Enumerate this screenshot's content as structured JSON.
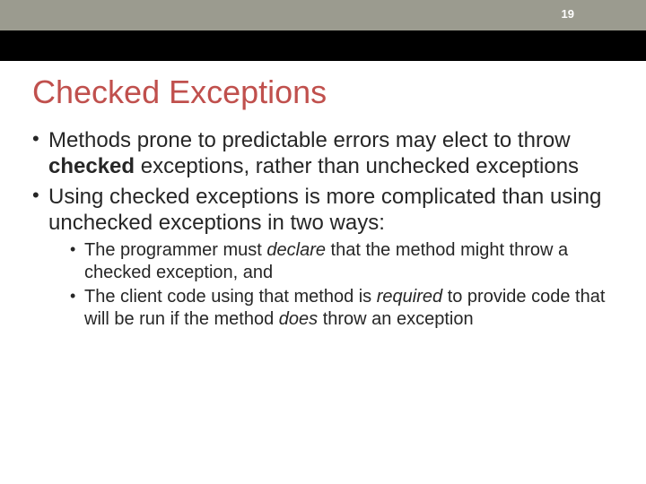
{
  "slide": {
    "page_number": "19",
    "title": "Checked Exceptions",
    "bullets": [
      {
        "pre": "Methods prone to predictable errors may elect to throw ",
        "bold": "checked",
        "post": " exceptions, rather than unchecked exceptions"
      },
      {
        "text": "Using checked exceptions is more complicated than using unchecked exceptions in two ways:"
      }
    ],
    "sub_bullets": [
      {
        "pre": "The programmer must ",
        "italic": "declare",
        "post": " that the method might throw a checked exception, and"
      },
      {
        "p1": "The client code using that method is ",
        "i1": "required",
        "p2": " to provide code that will be run if the method ",
        "i2": "does",
        "p3": " throw an exception"
      }
    ]
  }
}
